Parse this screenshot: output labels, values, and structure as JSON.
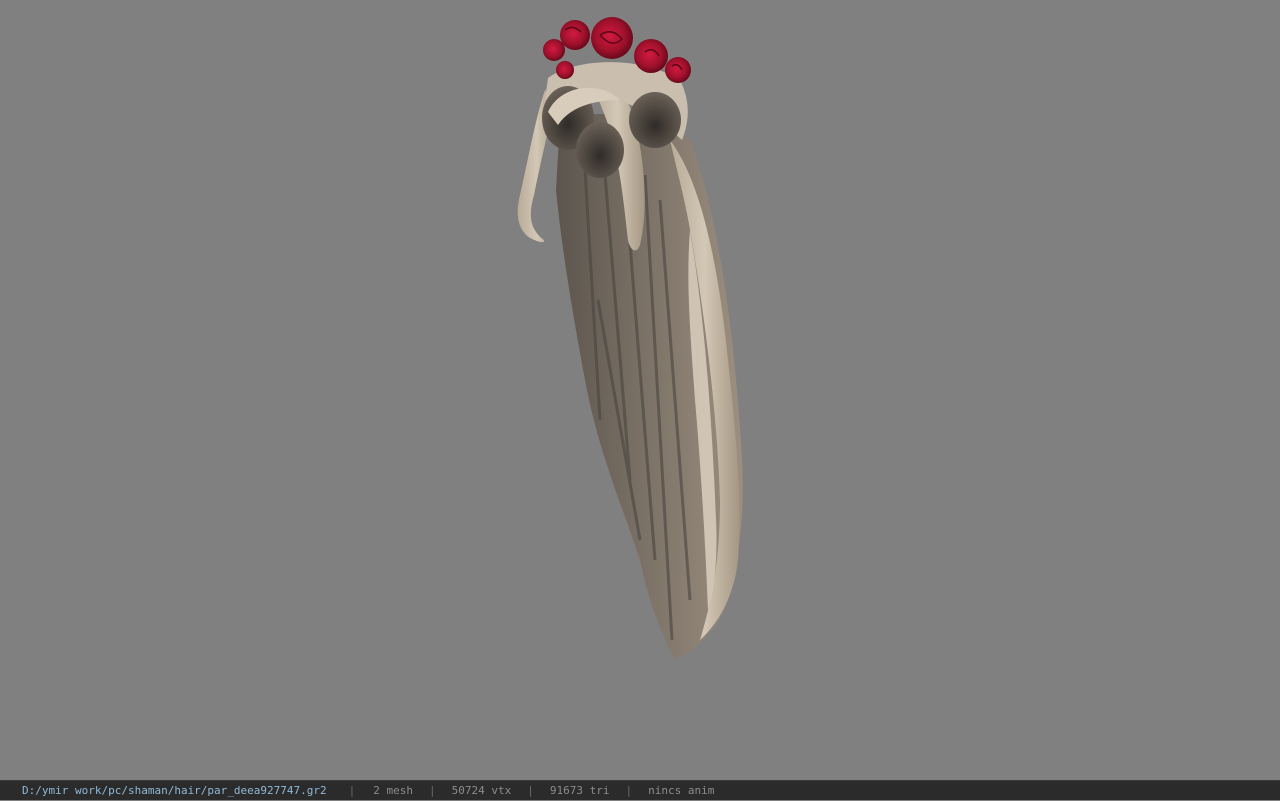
{
  "viewport": {
    "background_color": "#808080",
    "model": {
      "hair_color_light": "#cbbfae",
      "hair_color_dark": "#4a4540",
      "rose_color": "#a0112c"
    }
  },
  "status_bar": {
    "file_path": "D:/ymir work/pc/shaman/hair/par_deea927747.gr2",
    "separator": "|",
    "mesh": "2 mesh",
    "vtx": "50724 vtx",
    "tri": "91673 tri",
    "anim": "nincs anim",
    "path_color": "#8fb8d8",
    "text_color": "#8c8c8c"
  }
}
